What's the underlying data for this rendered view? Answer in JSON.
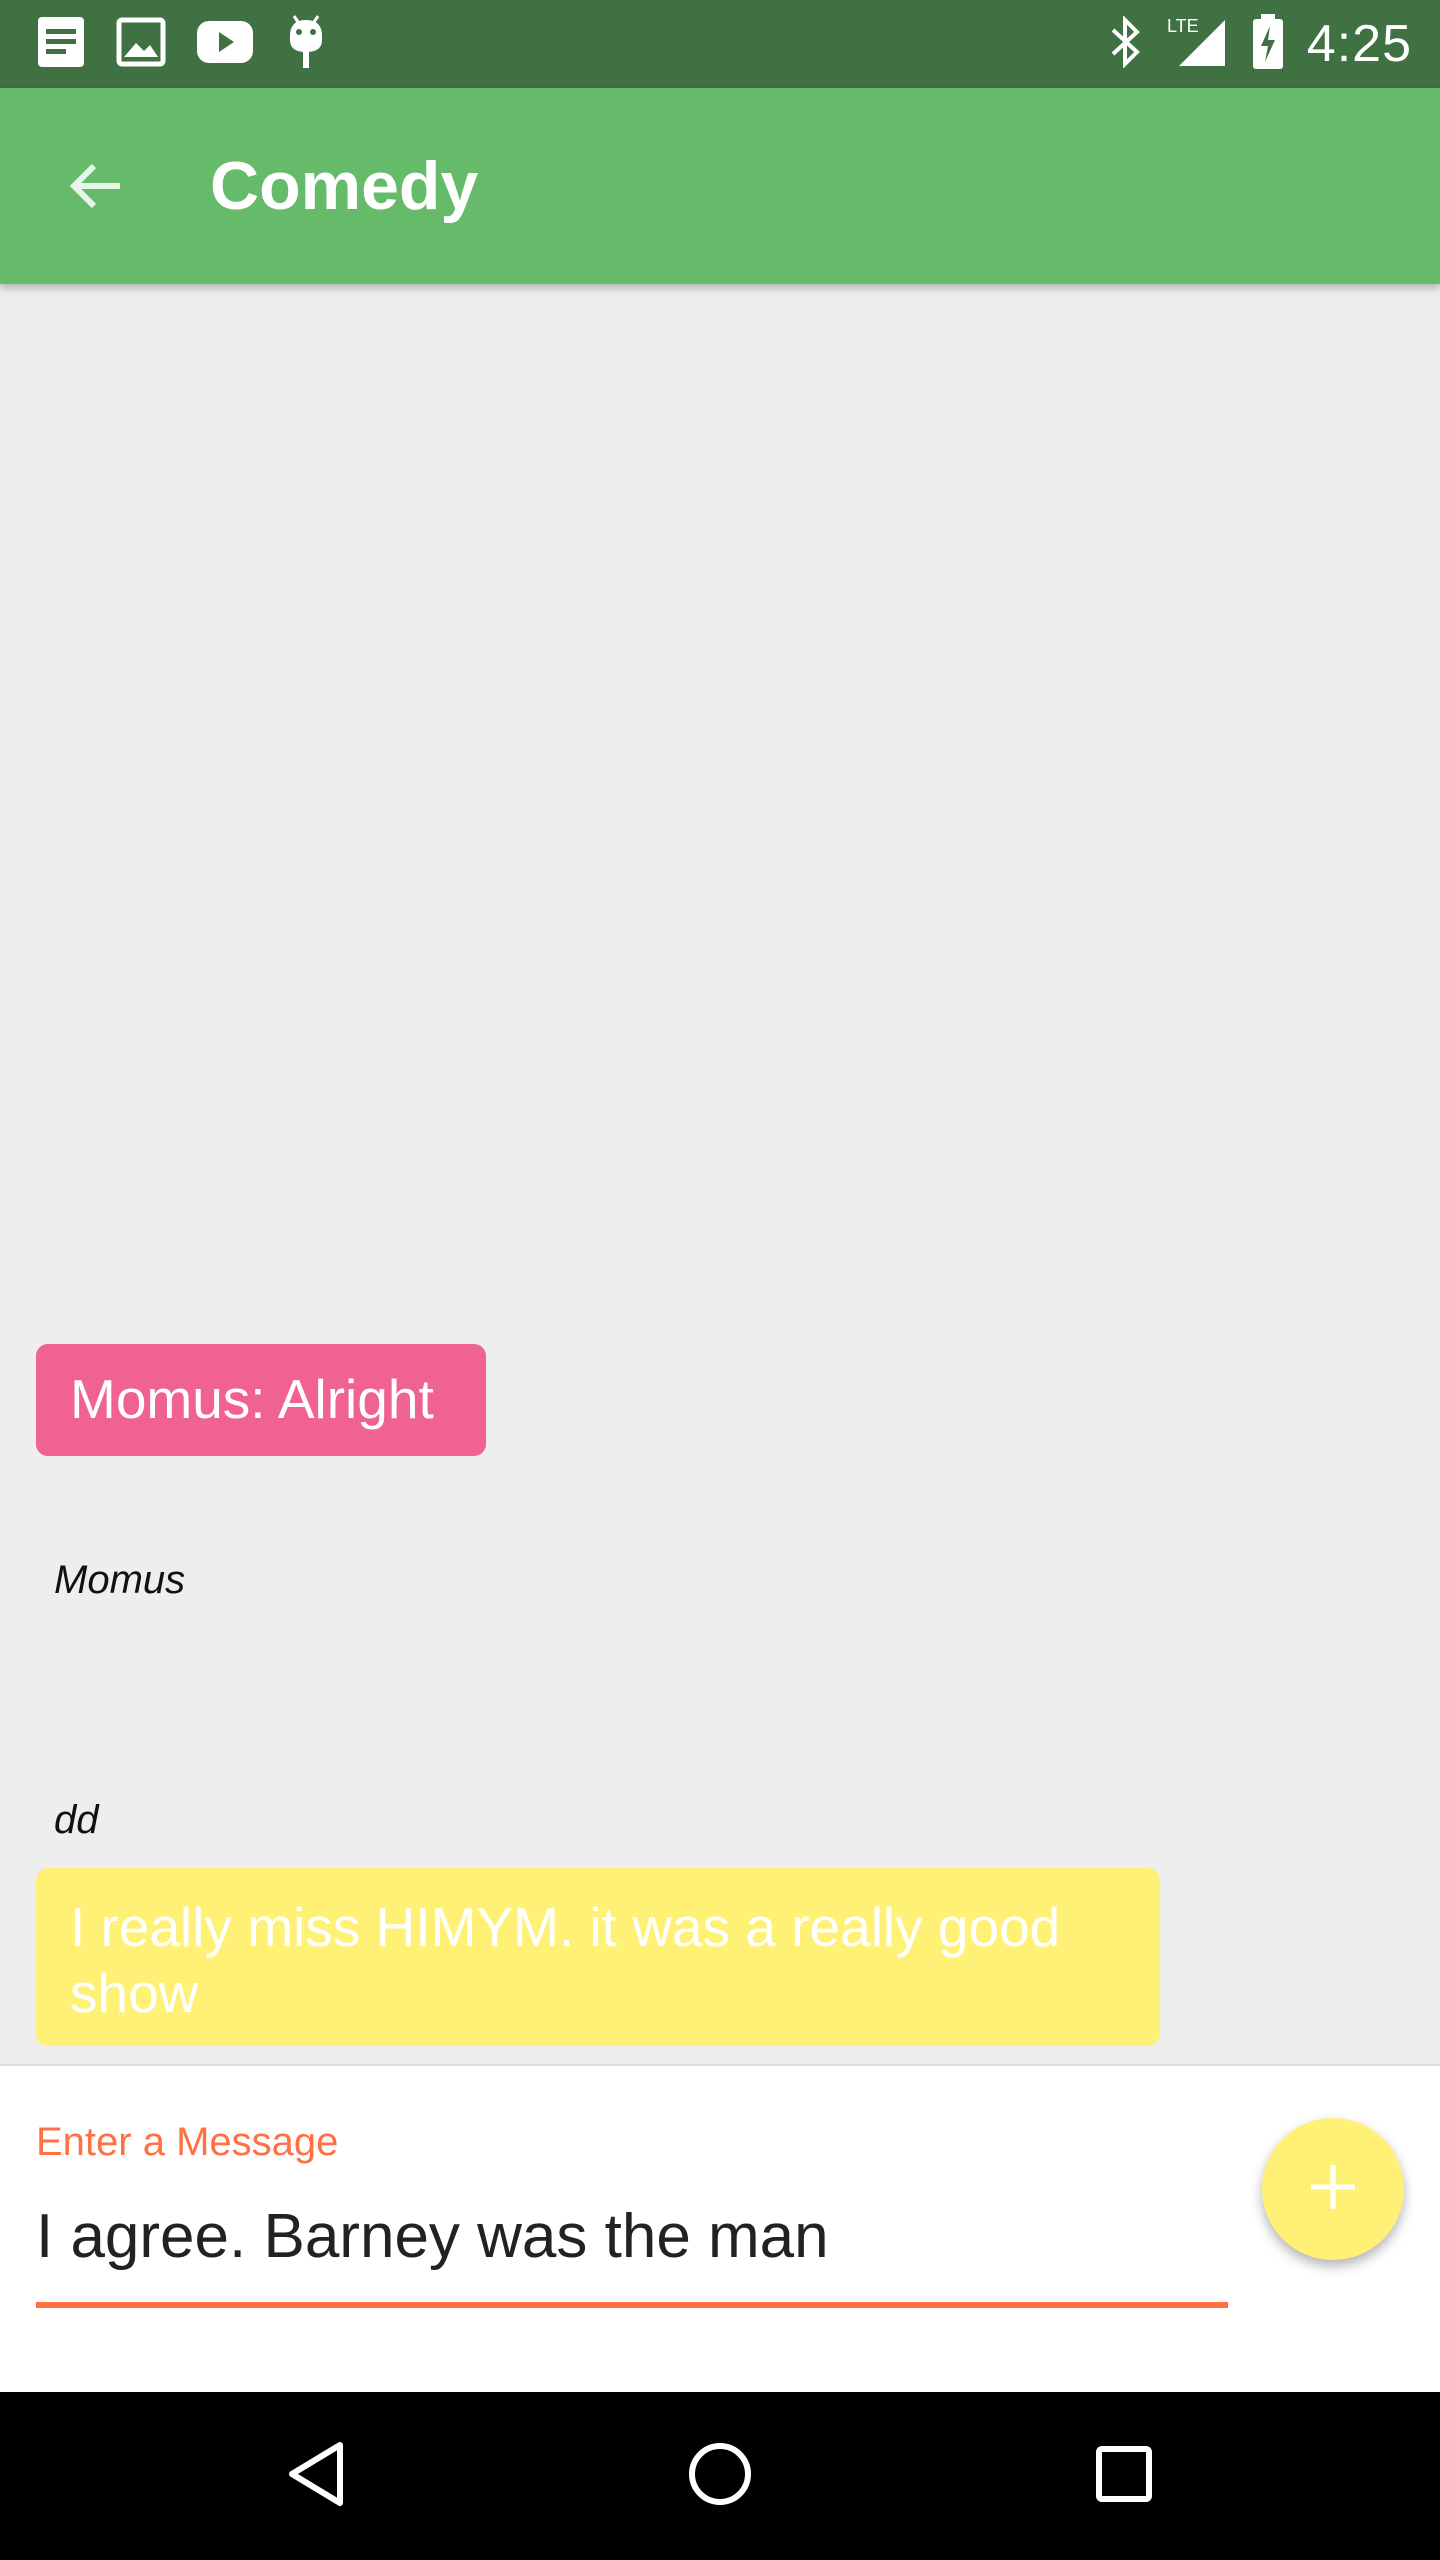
{
  "status_bar": {
    "time": "4:25",
    "left_icons": [
      "notes-icon",
      "image-icon",
      "youtube-icon",
      "android-debug-icon"
    ],
    "right_icons": [
      "bluetooth-icon",
      "lte-signal-icon",
      "battery-charging-icon"
    ],
    "network_label": "LTE"
  },
  "app_bar": {
    "title": "Comedy",
    "back_icon": "arrow-back-icon",
    "color": "#66bb6a"
  },
  "messages": [
    {
      "sender": "Momus",
      "text": "Momus: Alright",
      "color": "#f06292"
    },
    {
      "sender": "dd",
      "text": "I really miss HIMYM. it was a really good show",
      "color": "#fff176"
    }
  ],
  "composer": {
    "label": "Enter a Message",
    "value": "I agree. Barney was the man",
    "accent_color": "#ff7043",
    "fab_icon": "plus-icon"
  },
  "nav_bar": {
    "icons": [
      "back-triangle-icon",
      "home-circle-icon",
      "recents-square-icon"
    ]
  }
}
